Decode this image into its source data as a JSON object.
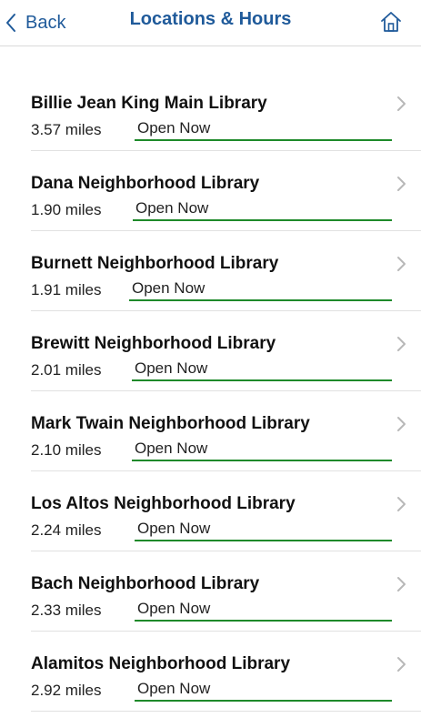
{
  "header": {
    "back_label": "Back",
    "title": "Locations & Hours",
    "home_icon": "home-icon"
  },
  "colors": {
    "accent": "#1f5a9a",
    "open_status": "#1e8a2a"
  },
  "locations": [
    {
      "name": "Billie Jean King Main Library",
      "distance": "3.57 miles",
      "status": "Open Now"
    },
    {
      "name": "Dana Neighborhood Library",
      "distance": "1.90 miles",
      "status": "Open Now"
    },
    {
      "name": "Burnett Neighborhood Library",
      "distance": "1.91 miles",
      "status": "Open Now"
    },
    {
      "name": "Brewitt Neighborhood Library",
      "distance": "2.01 miles",
      "status": "Open Now"
    },
    {
      "name": "Mark Twain Neighborhood Library",
      "distance": "2.10 miles",
      "status": "Open Now"
    },
    {
      "name": "Los Altos Neighborhood Library",
      "distance": "2.24 miles",
      "status": "Open Now"
    },
    {
      "name": "Bach Neighborhood Library",
      "distance": "2.33 miles",
      "status": "Open Now"
    },
    {
      "name": "Alamitos Neighborhood Library",
      "distance": "2.92 miles",
      "status": "Open Now"
    }
  ]
}
